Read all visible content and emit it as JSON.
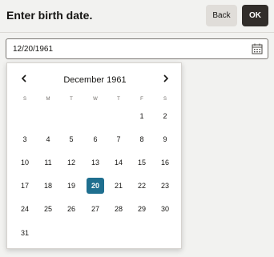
{
  "header": {
    "title": "Enter birth date.",
    "back_label": "Back",
    "ok_label": "OK"
  },
  "date_field": {
    "value": "12/20/1961",
    "calendar_icon": "calendar-icon"
  },
  "calendar": {
    "month_label": "December 1961",
    "prev_icon": "chevron-left-icon",
    "next_icon": "chevron-right-icon",
    "weekdays": [
      "S",
      "M",
      "T",
      "W",
      "T",
      "F",
      "S"
    ],
    "selected_day": "20",
    "weeks": [
      [
        "",
        "",
        "",
        "",
        "",
        "1",
        "2"
      ],
      [
        "3",
        "4",
        "5",
        "6",
        "7",
        "8",
        "9"
      ],
      [
        "10",
        "11",
        "12",
        "13",
        "14",
        "15",
        "16"
      ],
      [
        "17",
        "18",
        "19",
        "20",
        "21",
        "22",
        "23"
      ],
      [
        "24",
        "25",
        "26",
        "27",
        "28",
        "29",
        "30"
      ],
      [
        "31",
        "",
        "",
        "",
        "",
        "",
        ""
      ]
    ]
  },
  "colors": {
    "selected_day_bg": "#1f6f8f",
    "ok_button_bg": "#312d2a",
    "back_button_bg": "#e0ddd9"
  }
}
